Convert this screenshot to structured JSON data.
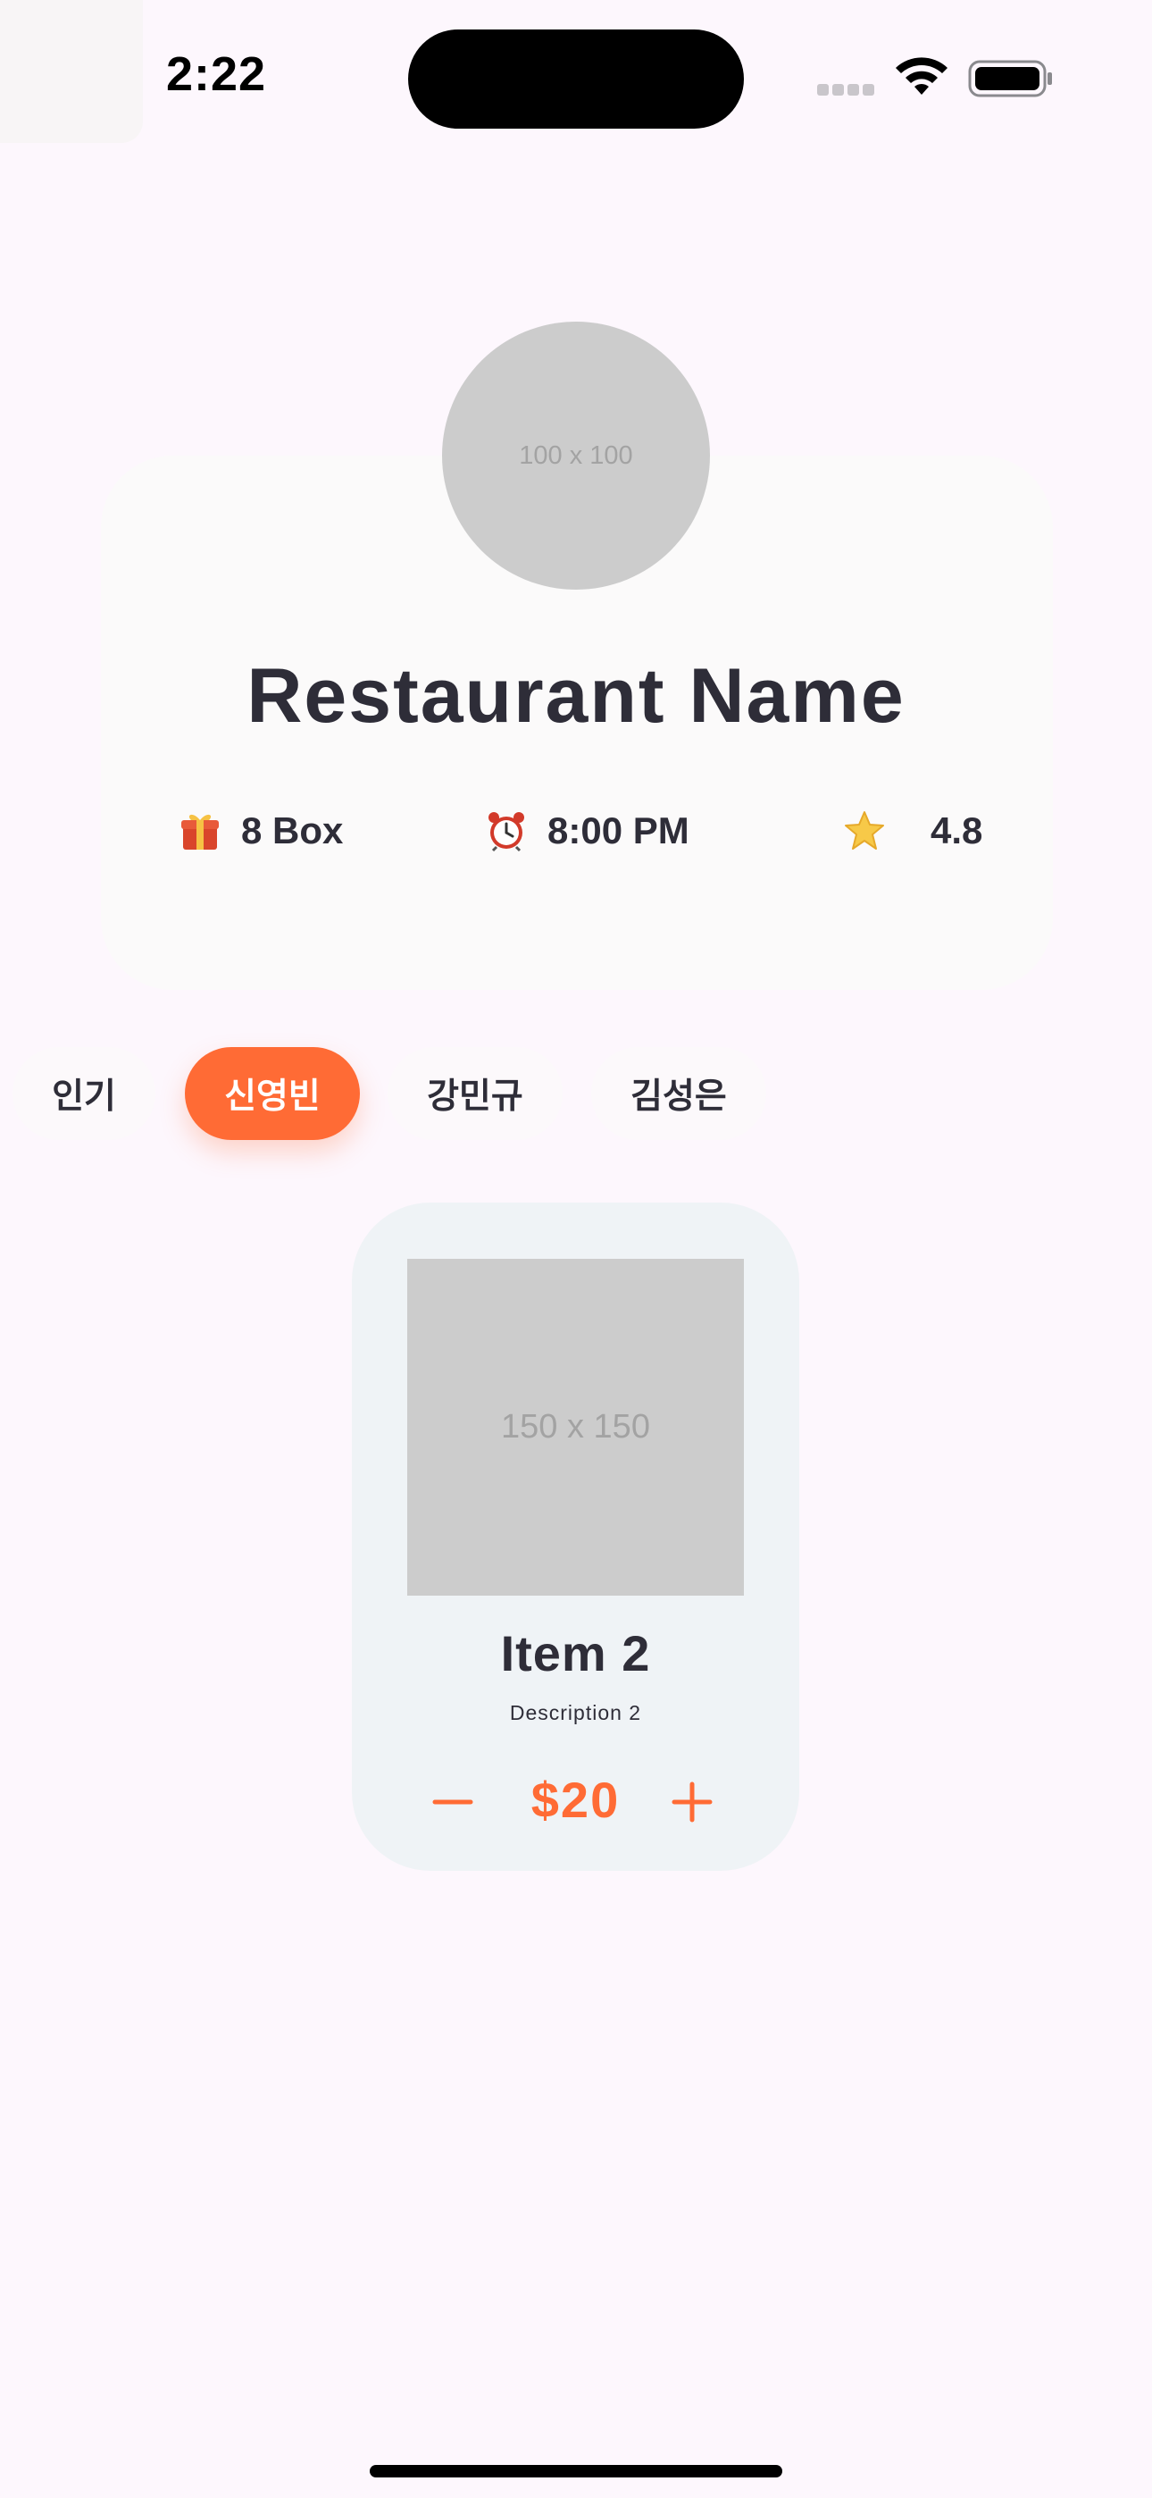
{
  "status_bar": {
    "time": "2:22"
  },
  "restaurant": {
    "avatar_placeholder": "100 x 100",
    "name": "Restaurant Name",
    "stats": {
      "boxes_icon": "gift-icon",
      "boxes": "8 Box",
      "time_icon": "alarm-clock-icon",
      "time": "8:00 PM",
      "rating_icon": "star-icon",
      "rating": "4.8"
    }
  },
  "tabs": [
    {
      "label": "인기",
      "active": false
    },
    {
      "label": "신영빈",
      "active": true
    },
    {
      "label": "강민규",
      "active": false
    },
    {
      "label": "김성은",
      "active": false
    }
  ],
  "item": {
    "image_placeholder": "150 x 150",
    "title": "Item 2",
    "description": "Description 2",
    "price": "$20"
  },
  "colors": {
    "accent": "#ff6b35",
    "text": "#2e2d38",
    "background": "#fdf7fd",
    "card": "#eff3f6",
    "placeholder": "#cccccc"
  }
}
